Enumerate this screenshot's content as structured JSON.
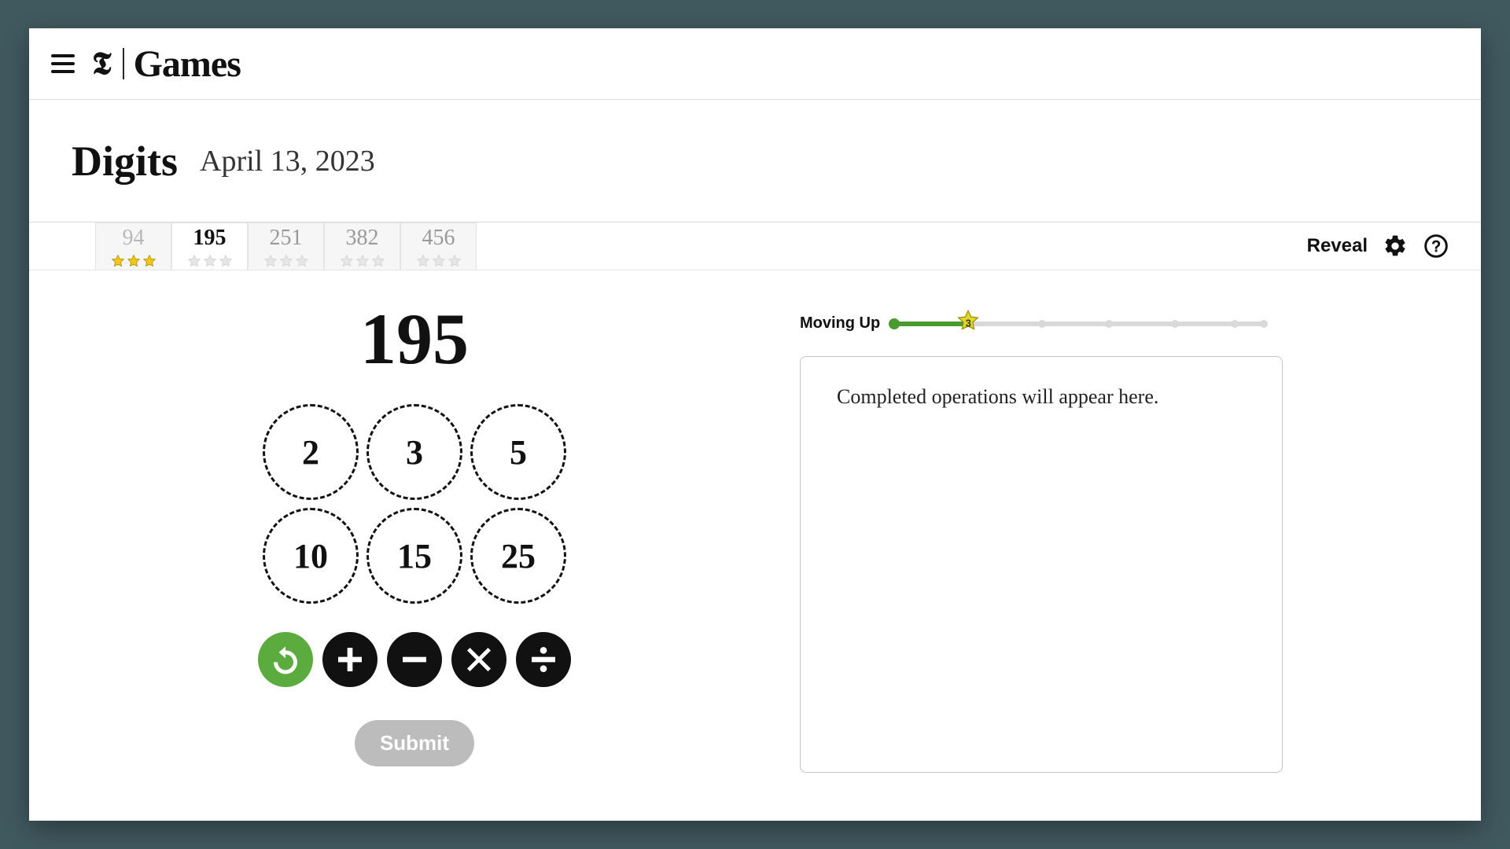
{
  "header": {
    "brand_logo_text": "𝕿",
    "brand_product": "Games"
  },
  "title": {
    "game_name": "Digits",
    "date": "April 13, 2023"
  },
  "tabs": [
    {
      "value": "94",
      "state": "completed",
      "stars": 3
    },
    {
      "value": "195",
      "state": "active",
      "stars": 0
    },
    {
      "value": "251",
      "state": "inactive",
      "stars": 0
    },
    {
      "value": "382",
      "state": "inactive",
      "stars": 0
    },
    {
      "value": "456",
      "state": "inactive",
      "stars": 0
    }
  ],
  "toolbar": {
    "reveal_label": "Reveal"
  },
  "play": {
    "target": "195",
    "numbers": [
      "2",
      "3",
      "5",
      "10",
      "15",
      "25"
    ],
    "submit_label": "Submit"
  },
  "progress": {
    "label": "Moving Up",
    "fill_percent": 20,
    "star_percent": 20,
    "star_value": "3",
    "dots_percent": [
      0,
      40,
      58,
      76,
      92,
      100
    ]
  },
  "panel": {
    "placeholder": "Completed operations will appear here."
  }
}
